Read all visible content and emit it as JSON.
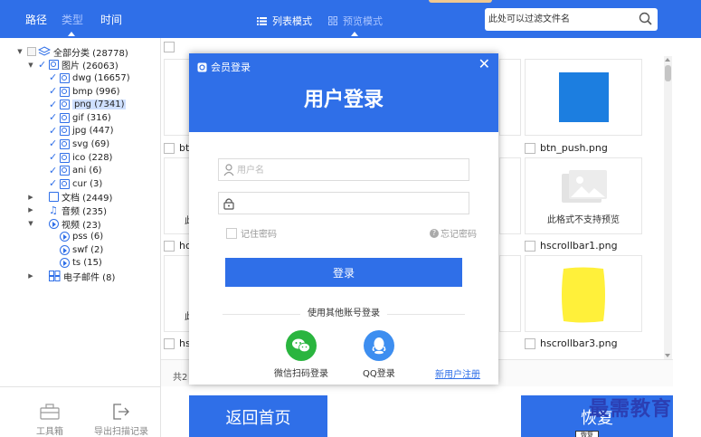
{
  "topbar": {
    "tabs": [
      "路径",
      "类型",
      "时间"
    ],
    "modes": [
      "列表模式",
      "预览模式"
    ],
    "search_placeholder": "此处可以过滤文件名"
  },
  "tree": {
    "root": "全部分类 (28778)",
    "images": "图片 (26063)",
    "image_types": [
      "dwg (16657)",
      "bmp (996)",
      "png (7341)",
      "gif (316)",
      "jpg (447)",
      "svg (69)",
      "ico (228)",
      "ani (6)",
      "cur (3)"
    ],
    "docs": "文档 (2449)",
    "audio": "音频 (235)",
    "video": "视频 (23)",
    "video_types": [
      "pss (6)",
      "swf (2)",
      "ts (15)"
    ],
    "email": "电子邮件 (8)"
  },
  "tools": {
    "toolbox": "工具箱",
    "export": "导出扫描记录"
  },
  "files": {
    "btn_push": "btn_push.png",
    "hscroll1": "hscrollbar1.png",
    "hscroll3": "hscrollbar3.png",
    "unsupported": "此格式不支持预览",
    "partial_bt": "bt",
    "partial_hc": "hc",
    "partial_hs": "hs",
    "partial_ci1": "此",
    "partial_ci2": "此"
  },
  "footer": {
    "count_partial": "共2"
  },
  "buttons": {
    "home": "返回首页",
    "restore_partial": "恢复"
  },
  "modal": {
    "brand": "会员登录",
    "title": "用户登录",
    "username_placeholder": "用户名",
    "password_placeholder": "",
    "remember": "记住密码",
    "forgot": "忘记密码",
    "login": "登录",
    "other": "使用其他账号登录",
    "wechat": "微信扫码登录",
    "qq": "QQ登录",
    "register": "新用户注册"
  },
  "watermark": "最需教育",
  "tooltip": "恢复",
  "colors": {
    "primary": "#2f6fe8",
    "wechat": "#2ab53f",
    "qq": "#3d8ef0",
    "preview_blue": "#1c7ee0",
    "preview_yellow": "#fff03a"
  }
}
